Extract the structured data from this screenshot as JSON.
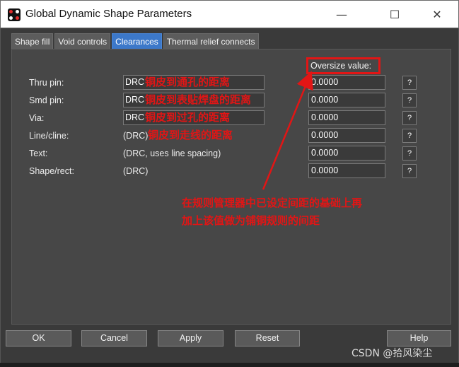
{
  "window": {
    "title": "Global Dynamic Shape Parameters",
    "minimize_glyph": "—",
    "maximize_glyph": "☐",
    "close_glyph": "✕"
  },
  "tabs": [
    {
      "label": "Shape fill",
      "active": false
    },
    {
      "label": "Void controls",
      "active": false
    },
    {
      "label": "Clearances",
      "active": true
    },
    {
      "label": "Thermal relief connects",
      "active": false
    }
  ],
  "clearances": {
    "oversize_label": "Oversize value:",
    "rows": [
      {
        "label": "Thru pin:",
        "drc": "DRC",
        "value": "0.0000",
        "help": "?"
      },
      {
        "label": "Smd pin:",
        "drc": "DRC",
        "value": "0.0000",
        "help": "?"
      },
      {
        "label": "Via:",
        "drc": "DRC",
        "value": "0.0000",
        "help": "?"
      },
      {
        "label": "Line/cline:",
        "drc": "(DRC)",
        "value": "0.0000",
        "help": "?"
      },
      {
        "label": "Text:",
        "drc": "(DRC, uses line spacing)",
        "value": "0.0000",
        "help": "?"
      },
      {
        "label": "Shape/rect:",
        "drc": "(DRC)",
        "value": "0.0000",
        "help": "?"
      }
    ]
  },
  "annotations": {
    "thru_pin": "铜皮到通孔的距离",
    "smd_pin": "铜皮到表贴焊盘的距离",
    "via": "铜皮到过孔的距离",
    "line": "铜皮到走线的距离",
    "note_line1": "在规则管理器中已设定间距的基础上再",
    "note_line2": "加上该值做为铺铜规则的间距"
  },
  "buttons": {
    "ok": "OK",
    "cancel": "Cancel",
    "apply": "Apply",
    "reset": "Reset",
    "help": "Help"
  },
  "watermark": "CSDN @拾风染尘",
  "colors": {
    "active_tab": "#3c78c9",
    "annotation_red": "#e21515"
  }
}
